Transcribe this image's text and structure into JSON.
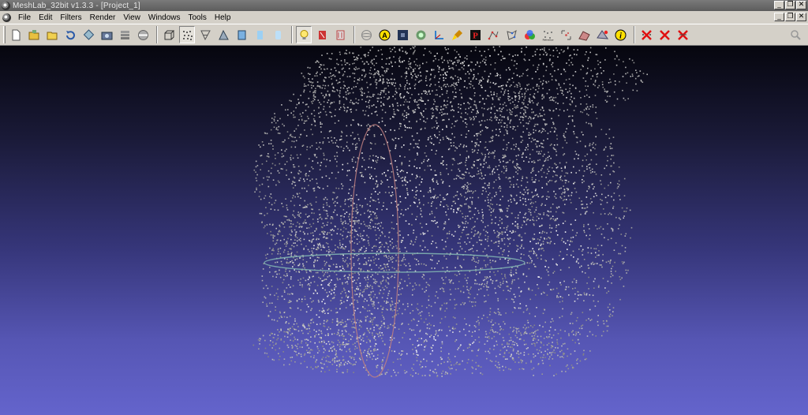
{
  "window": {
    "title": "MeshLab_32bit v1.3.3 - [Project_1]",
    "controls": {
      "minimize": "_",
      "restore": "❐",
      "close": "✕"
    }
  },
  "menu": {
    "items": [
      "File",
      "Edit",
      "Filters",
      "Render",
      "View",
      "Windows",
      "Tools",
      "Help"
    ]
  },
  "toolbar": {
    "groups": [
      [
        "new-project-icon",
        "open-project-icon",
        "import-mesh-icon",
        "reload-icon",
        "export-mesh-icon",
        "snapshot-icon",
        "layers-icon",
        "properties-icon"
      ],
      [
        "bounding-box-icon",
        "points-icon",
        "wireframe-icon",
        "hidden-lines-icon",
        "flat-lines-icon",
        "flat-icon",
        "smooth-icon"
      ],
      [
        "light-on-icon",
        "double-side-lighting-icon",
        "back-face-icon"
      ],
      [
        "trackball-icon",
        "info-a-icon",
        "texture-icon",
        "colorize-icon",
        "axis-icon",
        "paint-icon",
        "pick-points-icon",
        "select-vertices-icon",
        "select-faces-icon",
        "measure-icon",
        "align-icon",
        "reference-icon",
        "select-region-icon",
        "manipulator-icon",
        "quality-icon",
        "about-icon"
      ],
      [
        "delete-selected-vertices-icon",
        "delete-selected-faces-icon",
        "delete-all-icon"
      ]
    ],
    "active_tool": "points-icon",
    "search_icon": "magnifier-icon"
  },
  "viewport": {
    "background_top": "#06060e",
    "background_bottom": "#6464cc",
    "point_color": "#e6e6e6",
    "trackball_colors": [
      "#c08080",
      "#80b0b0"
    ]
  }
}
